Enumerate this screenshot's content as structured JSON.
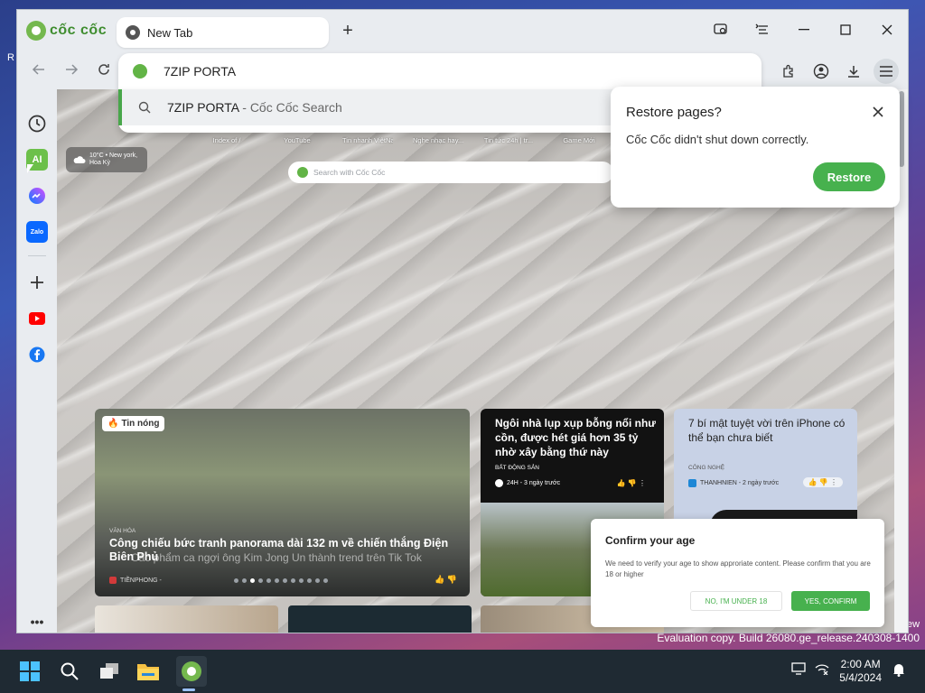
{
  "desktop": {
    "left_glyph": "R",
    "bottom_right_fragment": "ew",
    "watermark": "Evaluation copy. Build 26080.ge_release.240308-1400"
  },
  "browser": {
    "brand": "cốc cốc",
    "tab_title": "New Tab",
    "new_tab_label": "+",
    "omnibox_text": "7ZIP PORTA",
    "suggestion": {
      "query": "7ZIP PORTA",
      "source": " - Cốc Cốc Search"
    }
  },
  "page": {
    "weather": "10°C • New york, Hoa Kỳ",
    "shortcuts": [
      "Index of /",
      "YouTube",
      "Tin nhanh ViệtNam...",
      "Nghe nhạc hay...",
      "Tin tức 24h | tr...",
      "Game Mới"
    ],
    "search_placeholder": "Search with Cốc Cốc",
    "card_main": {
      "badge": "Tin nóng",
      "category": "VĂN HÓA",
      "headline": "Công chiếu bức tranh panorama dài 132 m về chiến thắng Điện Biên Phủ",
      "ghost_headline": "Các phẩm ca ngợi ông Kim Jong Un thành trend trên Tik Tok",
      "source": "TIỀNPHONG -"
    },
    "card_dark": {
      "headline": "Ngôi nhà lụp xụp bỗng nổi như cồn, được hét giá hơn 35 tỷ nhờ xây bằng thứ này",
      "category": "BẤT ĐỘNG SẢN",
      "source": "24H - 3 ngày trước"
    },
    "card_light": {
      "headline": "7 bí mật tuyệt vời trên iPhone có thể bạn chưa biết",
      "category": "CÔNG NGHỆ",
      "source": "THANHNIEN - 2 ngày trước"
    }
  },
  "restore_popup": {
    "title": "Restore pages?",
    "message": "Cốc Cốc didn't shut down correctly.",
    "button": "Restore"
  },
  "age_popup": {
    "title": "Confirm your age",
    "message": "We need to verify your age to show approriate content. Please confirm that you are 18 or higher",
    "no_label": "NO, I'M UNDER 18",
    "yes_label": "YES, CONFIRM"
  },
  "taskbar": {
    "time": "2:00 AM",
    "date": "5/4/2024"
  },
  "colors": {
    "accent_green": "#47b14e",
    "taskbar": "#1f2a33"
  }
}
